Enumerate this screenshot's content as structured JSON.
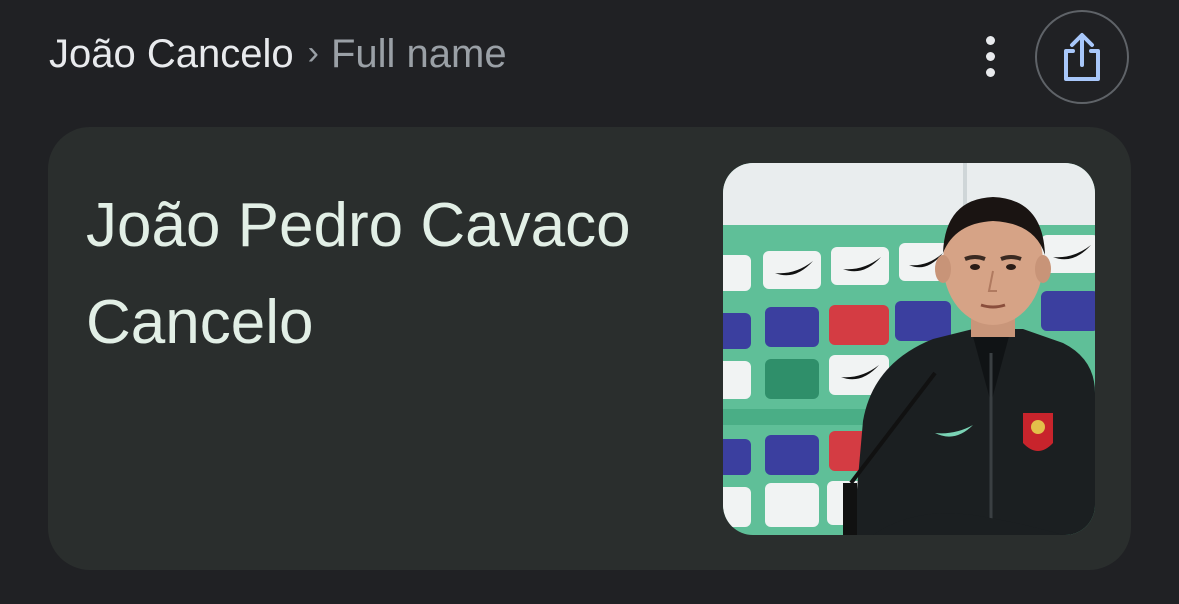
{
  "breadcrumb": {
    "parent": "João Cancelo",
    "separator": "›",
    "current": "Full name"
  },
  "actions": {
    "more_icon": "more-vert-icon",
    "share_icon": "share-icon"
  },
  "result": {
    "full_name": "João Pedro Cavaco Cancelo"
  },
  "colors": {
    "background": "#202124",
    "card": "#2a2e2d",
    "name_text": "#e2efe6",
    "breadcrumb_muted": "#9aa0a6",
    "share_icon": "#a8c7fa"
  }
}
